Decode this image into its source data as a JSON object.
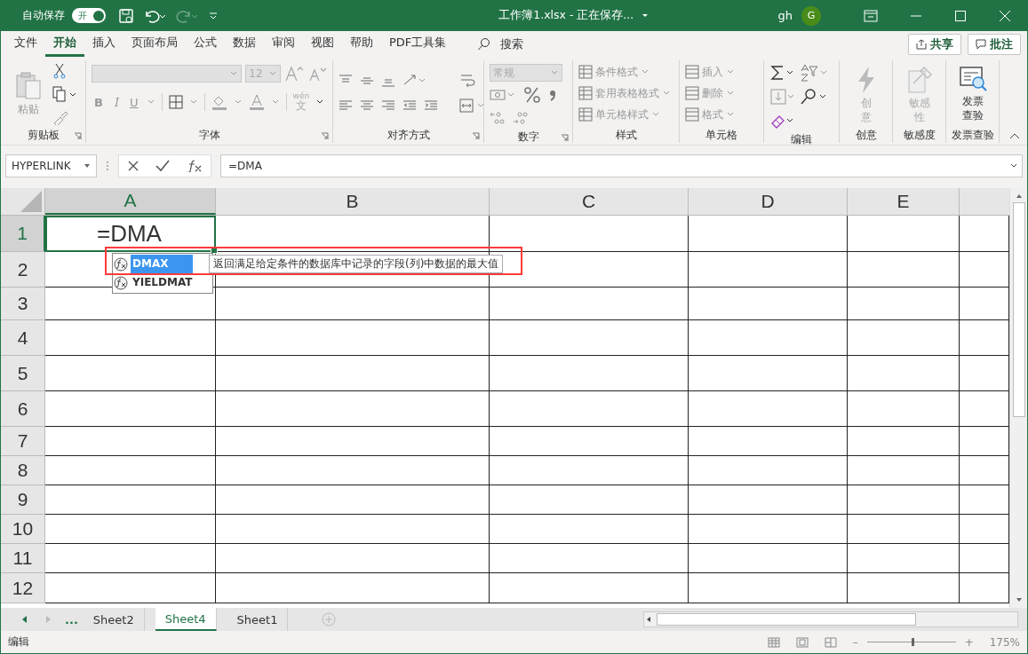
{
  "title_bar": {
    "autosave_label": "自动保存",
    "autosave_toggle": {
      "label": "开",
      "on": true
    },
    "title": "工作簿1.xlsx - 正在保存...",
    "user": "gh",
    "avatar": "G"
  },
  "menu_tabs": [
    {
      "label": "文件",
      "selected": false
    },
    {
      "label": "开始",
      "selected": true
    },
    {
      "label": "插入",
      "selected": false
    },
    {
      "label": "页面布局",
      "selected": false
    },
    {
      "label": "公式",
      "selected": false
    },
    {
      "label": "数据",
      "selected": false
    },
    {
      "label": "审阅",
      "selected": false
    },
    {
      "label": "视图",
      "selected": false
    },
    {
      "label": "帮助",
      "selected": false
    },
    {
      "label": "PDF工具集",
      "selected": false
    }
  ],
  "search": "搜索",
  "share_button": "共享",
  "comments_button": "批注",
  "ribbon": {
    "clipboard": {
      "label": "剪贴板",
      "paste": "粘贴"
    },
    "font": {
      "label": "字体",
      "font_size": "12",
      "bold": "B",
      "italic": "I",
      "underline": "U",
      "phonetic_top": "wén",
      "phonetic_bottom": "文"
    },
    "alignment": {
      "label": "对齐方式"
    },
    "number": {
      "label": "数字",
      "format": "常规"
    },
    "styles": {
      "label": "样式",
      "items": [
        "条件格式",
        "套用表格格式",
        "单元格样式"
      ]
    },
    "cells": {
      "label": "单元格",
      "items": [
        "插入",
        "删除",
        "格式"
      ]
    },
    "editing": {
      "label": "编辑"
    },
    "ideas": {
      "label": "创意",
      "button": "创意"
    },
    "sensitivity": {
      "label": "敏感度",
      "button": "敏感性"
    },
    "invoice": {
      "label": "发票查验",
      "button": "发票查验"
    }
  },
  "formula_bar": {
    "name_box": "HYPERLINK",
    "formula": "=DMA"
  },
  "columns": [
    {
      "label": "A",
      "selected": true
    },
    {
      "label": "B",
      "selected": false
    },
    {
      "label": "C",
      "selected": false
    },
    {
      "label": "D",
      "selected": false
    },
    {
      "label": "E",
      "selected": false
    }
  ],
  "rows": [
    {
      "label": "1",
      "selected": true
    },
    {
      "label": "2",
      "selected": false
    },
    {
      "label": "3",
      "selected": false
    },
    {
      "label": "4",
      "selected": false
    },
    {
      "label": "5",
      "selected": false
    },
    {
      "label": "6",
      "selected": false
    },
    {
      "label": "7",
      "selected": false
    },
    {
      "label": "8",
      "selected": false
    },
    {
      "label": "9",
      "selected": false
    },
    {
      "label": "10",
      "selected": false
    },
    {
      "label": "11",
      "selected": false
    },
    {
      "label": "12",
      "selected": false
    }
  ],
  "active_cell": "=DMA",
  "autocomplete": {
    "items": [
      {
        "name": "DMAX",
        "selected": true
      },
      {
        "name": "YIELDMAT",
        "selected": false
      }
    ],
    "tooltip": "返回满足给定条件的数据库中记录的字段(列)中数据的最大值"
  },
  "sheet_tabs": {
    "more": "...",
    "tabs": [
      {
        "label": "Sheet2",
        "selected": false
      },
      {
        "label": "Sheet4",
        "selected": true
      },
      {
        "label": "Sheet1",
        "selected": false
      }
    ]
  },
  "status_bar": {
    "mode": "编辑",
    "zoom": "175%",
    "zoom_out": "–",
    "zoom_in": "+",
    "zoom_level": {
      "level": 0.5
    }
  }
}
